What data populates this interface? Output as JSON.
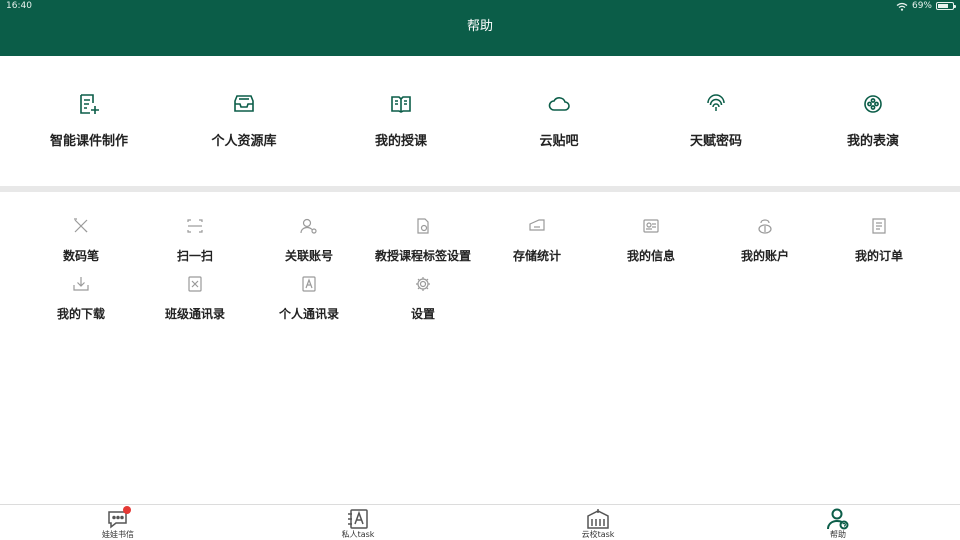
{
  "status": {
    "time": "16:40",
    "battery": "69%",
    "battery_level": 0.69
  },
  "header": {
    "title": "帮助"
  },
  "features": [
    {
      "label": "智能课件制作",
      "icon": "courseware-edit-icon"
    },
    {
      "label": "个人资源库",
      "icon": "inbox-tray-icon"
    },
    {
      "label": "我的授课",
      "icon": "open-book-icon"
    },
    {
      "label": "云贴吧",
      "icon": "cloud-icon"
    },
    {
      "label": "天赋密码",
      "icon": "fingerprint-icon"
    },
    {
      "label": "我的表演",
      "icon": "film-reel-icon"
    }
  ],
  "tools": [
    {
      "label": "数码笔",
      "icon": "pen-tools-icon"
    },
    {
      "label": "扫一扫",
      "icon": "scan-icon"
    },
    {
      "label": "关联账号",
      "icon": "link-account-icon"
    },
    {
      "label": "教授课程标签设置",
      "icon": "tag-settings-icon"
    },
    {
      "label": "存储统计",
      "icon": "storage-stats-icon"
    },
    {
      "label": "我的信息",
      "icon": "id-card-icon"
    },
    {
      "label": "我的账户",
      "icon": "wallet-icon"
    },
    {
      "label": "我的订单",
      "icon": "order-list-icon"
    },
    {
      "label": "我的下载",
      "icon": "download-icon"
    },
    {
      "label": "班级通讯录",
      "icon": "class-contacts-icon"
    },
    {
      "label": "个人通讯录",
      "icon": "personal-contacts-icon"
    },
    {
      "label": "设置",
      "icon": "gear-icon"
    }
  ],
  "tabs": [
    {
      "label": "娃娃书信",
      "icon": "chat-bubble-icon",
      "has_badge": true
    },
    {
      "label": "私人task",
      "icon": "notebook-a-icon",
      "has_badge": false
    },
    {
      "label": "云校task",
      "icon": "school-building-icon",
      "has_badge": false
    },
    {
      "label": "帮助",
      "icon": "help-person-icon",
      "has_badge": false,
      "active": true
    }
  ],
  "colors": {
    "brand": "#0b5d48",
    "icon_gray": "#9a9a9a",
    "badge": "#e53935",
    "divider": "#e8e8e8"
  }
}
